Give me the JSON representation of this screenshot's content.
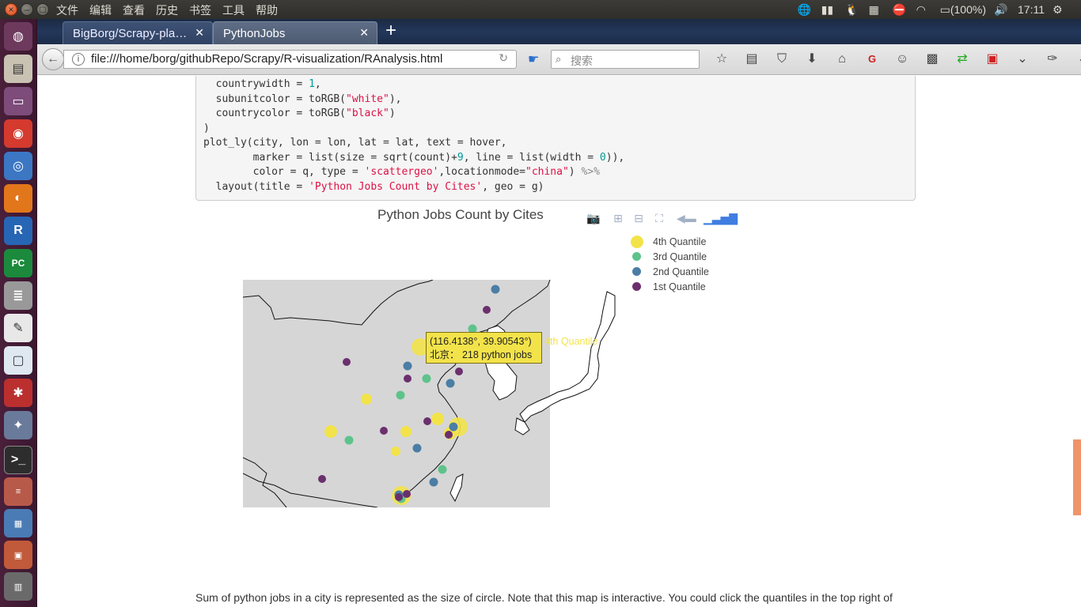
{
  "menu": {
    "file": "文件",
    "edit": "编辑",
    "view": "查看",
    "history": "历史",
    "bookmarks": "书签",
    "tools": "工具",
    "help": "帮助"
  },
  "tray": {
    "battery": "(100%)",
    "time": "17:11"
  },
  "tabs": [
    {
      "label": "BigBorg/Scrapy-pla…"
    },
    {
      "label": "PythonJobs"
    }
  ],
  "nav": {
    "url": "file:///home/borg/githubRepo/Scrapy/R-visualization/RAnalysis.html",
    "search_placeholder": "搜索"
  },
  "code": {
    "line1": "  countrywidth = ",
    "line1_num": "1",
    "line1_end": ",",
    "line2": "  subunitcolor = toRGB(",
    "line2_str": "\"white\"",
    "line2_end": "),",
    "line3": "  countrycolor = toRGB(",
    "line3_str": "\"black\"",
    "line3_end": ")",
    "line4": ")",
    "line5": "plot_ly(city, lon = lon, lat = lat, text = hover,",
    "line6a": "        marker = list(size = sqrt(count)+",
    "line6_num1": "9",
    "line6b": ", line = list(width = ",
    "line6_num2": "0",
    "line6c": ")),",
    "line7a": "        color = q, type = ",
    "line7_str1": "'scattergeo'",
    "line7b": ",locationmode=",
    "line7_str2": "\"china\"",
    "line7c": ") ",
    "line7_op": "%>%",
    "line8a": "  layout(title = ",
    "line8_str": "'Python Jobs Count by Cites'",
    "line8b": ", geo = g)"
  },
  "plot": {
    "title": "Python Jobs Count by Cites",
    "legend": [
      {
        "label": "4th  Quantile",
        "color": "#f3e34a",
        "size": 16
      },
      {
        "label": "3rd  Quantile",
        "color": "#5dc38b",
        "size": 11
      },
      {
        "label": "2nd  Quantile",
        "color": "#4b7ea5",
        "size": 11
      },
      {
        "label": "1st  Quantile",
        "color": "#6b2f6e",
        "size": 11
      }
    ],
    "tooltip": {
      "coords": "(116.4138°, 39.90543°)",
      "text": "北京：  218  python jobs",
      "series": "4th  Quantile"
    }
  },
  "description": "Sum of python jobs in a city is represented as the size of circle. Note that this map is interactive. You could click the quantiles in the top right of"
}
